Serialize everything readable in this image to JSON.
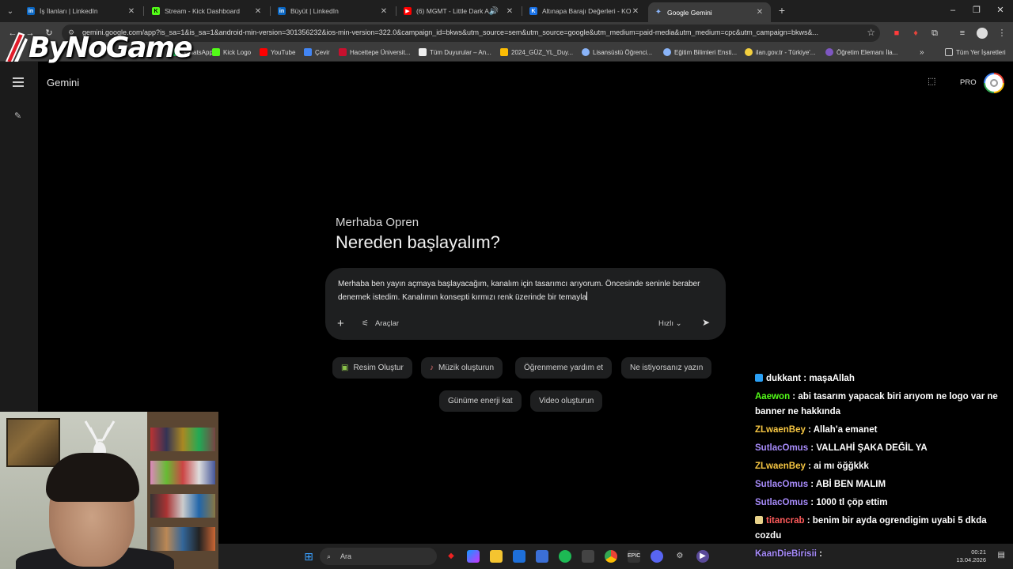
{
  "browser": {
    "tabs": [
      {
        "title": "İş İlanları | LinkedIn",
        "favicon": "linkedin-icon",
        "color": "#0a66c2"
      },
      {
        "title": "Stream - Kick Dashboard",
        "favicon": "kick-icon",
        "color": "#53fc18"
      },
      {
        "title": "Büyüt | LinkedIn",
        "favicon": "linkedin-icon",
        "color": "#0a66c2"
      },
      {
        "title": "(6) MGMT - Little Dark Age",
        "favicon": "youtube-icon",
        "color": "#ff0000"
      },
      {
        "title": "Altınapa Barajı Değerleri - KOSKİ",
        "favicon": "koski-icon",
        "color": "#1a73e8"
      },
      {
        "title": "Google Gemini",
        "favicon": "gemini-icon",
        "color": "#8ab4f8"
      }
    ],
    "url": "gemini.google.com/app?is_sa=1&is_sa=1&android-min-version=301356232&ios-min-version=322.0&campaign_id=bkws&utm_source=sem&utm_source=google&utm_medium=paid-media&utm_medium=cpc&utm_campaign=bkws&...",
    "bookmarks": [
      {
        "label": "WhatsApp",
        "color": "#25d366"
      },
      {
        "label": "Kick Logo",
        "color": "#53fc18"
      },
      {
        "label": "YouTube",
        "color": "#ff0000"
      },
      {
        "label": "Çevir",
        "color": "#4285f4"
      },
      {
        "label": "Hacettepe Üniversit...",
        "color": "#c8102e"
      },
      {
        "label": "Tüm Duyurular – An...",
        "color": "#eeeeee"
      },
      {
        "label": "2024_GÜZ_YL_Duy...",
        "color": "#fbbc04"
      },
      {
        "label": "Lisansüstü Öğrenci...",
        "color": "#8ab4f8"
      },
      {
        "label": "Eğitim Bilimleri Ensti...",
        "color": "#8ab4f8"
      },
      {
        "label": "ilan.gov.tr - Türkiye'...",
        "color": "#f4d03f"
      },
      {
        "label": "Öğretim Elemanı İla...",
        "color": "#7e57c2"
      }
    ],
    "all_bookmarks_label": "Tüm Yer İşaretleri"
  },
  "overlay_logo": "ByNoGame",
  "gemini": {
    "app_title": "Gemini",
    "pro_label": "PRO",
    "greeting": "Merhaba Opren",
    "headline": "Nereden başlayalım?",
    "prompt_text": "Merhaba ben yayın açmaya başlayacağım, kanalım için tasarımcı arıyorum. Öncesinde seninle beraber denemek istedim. Kanalımın konsepti kırmızı renk üzerinde bir temayla",
    "tools_label": "Araçlar",
    "mode_label": "Hızlı",
    "chips": [
      {
        "label": "Resim Oluştur",
        "icon": "image-icon"
      },
      {
        "label": "Müzik oluşturun",
        "icon": "guitar-icon"
      },
      {
        "label": "Öğrenmeme yardım et",
        "icon": ""
      },
      {
        "label": "Ne istiyorsanız yazın",
        "icon": ""
      },
      {
        "label": "Günüme enerji kat",
        "icon": ""
      },
      {
        "label": "Video oluşturun",
        "icon": ""
      }
    ]
  },
  "chat": [
    {
      "user": "dukkant",
      "text": ": maşaAllah",
      "color": "#ffffff",
      "badge": "#2aa0f5"
    },
    {
      "user": "Aaewon",
      "text": ": abi tasarım yapacak biri arıyom ne logo var ne banner ne hakkında",
      "color": "#53fc18",
      "badge": ""
    },
    {
      "user": "ZLwaenBey",
      "text": ": Allah'a emanet",
      "color": "#f5c542",
      "badge": ""
    },
    {
      "user": "SutlacOmus",
      "text": ": VALLAHİ ŞAKA DEĞİL YA",
      "color": "#a78bfa",
      "badge": ""
    },
    {
      "user": "ZLwaenBey",
      "text": ": ai mı öğğkkk",
      "color": "#f5c542",
      "badge": ""
    },
    {
      "user": "SutlacOmus",
      "text": ": ABİ BEN MALIM",
      "color": "#a78bfa",
      "badge": ""
    },
    {
      "user": "SutlacOmus",
      "text": ": 1000 tl çöp ettim",
      "color": "#a78bfa",
      "badge": ""
    },
    {
      "user": "titancrab",
      "text": ": benim bir ayda ogrendigim uyabi 5 dkda cozdu",
      "color": "#ff5b5b",
      "badge": "#e8d28a"
    },
    {
      "user": "KaanDieBirisii",
      "text": ":",
      "color": "#a78bfa",
      "badge": ""
    }
  ],
  "taskbar": {
    "search_label": "Ara",
    "time": "00:21",
    "date": "13.04.2026"
  }
}
